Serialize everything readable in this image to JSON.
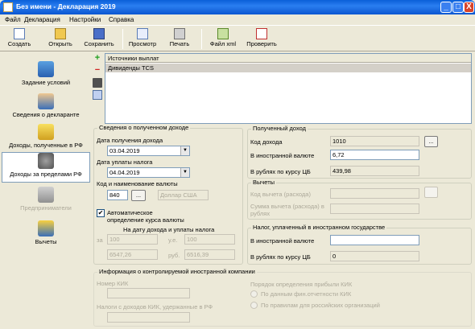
{
  "window": {
    "title": "Без имени - Декларация 2019",
    "controls": [
      "_",
      "□",
      "X"
    ]
  },
  "menu": [
    "Файл",
    "Декларация",
    "Настройки",
    "Справка"
  ],
  "toolbar": {
    "create": "Создать",
    "open": "Открыть",
    "save": "Сохранить",
    "preview": "Просмотр",
    "print": "Печать",
    "file_xml": "Файл xml",
    "check": "Проверить"
  },
  "nav": {
    "conditions": "Задание условий",
    "declarant": "Сведения о декларанте",
    "income_rf": "Доходы, полученные в РФ",
    "income_abroad": "Доходы за пределами РФ",
    "entrepreneurs": "Предприниматели",
    "deductions": "Вычеты"
  },
  "side_tools": {
    "add": "+",
    "remove": "−"
  },
  "sources": {
    "header": "Источники выплат",
    "rows": [
      "Дивиденды TCS"
    ]
  },
  "income_info": {
    "title": "Сведения о полученном доходе",
    "date_received_label": "Дата получения дохода",
    "date_received": "03.04.2019",
    "date_tax_label": "Дата уплаты налога",
    "date_tax": "04.04.2019",
    "currency_label": "Код и наименование валюты",
    "currency_code": "840",
    "currency_btn": "...",
    "currency_name": "Доллар США",
    "auto_rate_label": "Автоматическое определение курса валюты",
    "auto_rate_checked": "✔",
    "rate_dates_label": "На дату дохода и уплаты налога",
    "for_label": "за",
    "for_value1": "100",
    "u_label": "у.е.",
    "for_value2": "100",
    "rate1": "6547,26",
    "rub_label": "руб.",
    "rate2": "6516,39"
  },
  "received_income": {
    "title": "Полученный доход",
    "code_label": "Код дохода",
    "code": "1010",
    "code_btn": "...",
    "foreign_label": "В иностранной валюте",
    "foreign_value": "6,72",
    "rub_label": "В рублях по курсу ЦБ",
    "rub_value": "439,98"
  },
  "deductions": {
    "title": "Вычеты",
    "code_label": "Код вычета (расхода)",
    "sum_label": "Сумма вычета (расхода) в рублях"
  },
  "foreign_tax": {
    "title": "Налог, уплаченный в иностранном государстве",
    "foreign_label": "В иностранной валюте",
    "rub_label": "В рублях по курсу ЦБ",
    "rub_value": "0"
  },
  "kik": {
    "title": "Информация о контролируемой иностранной компании",
    "number_label": "Номер КИК",
    "tax_label": "Налоги с доходов КИК, удержанные в РФ",
    "profit_order_label": "Порядок определения прибыли КИК",
    "option1": "По данным фин.отчетности КИК",
    "option2": "По правилам для российских организаций"
  },
  "colors": {
    "title_bar": "#0a5fd8",
    "window_bg": "#ece9d8",
    "close_button": "#d8442a"
  }
}
